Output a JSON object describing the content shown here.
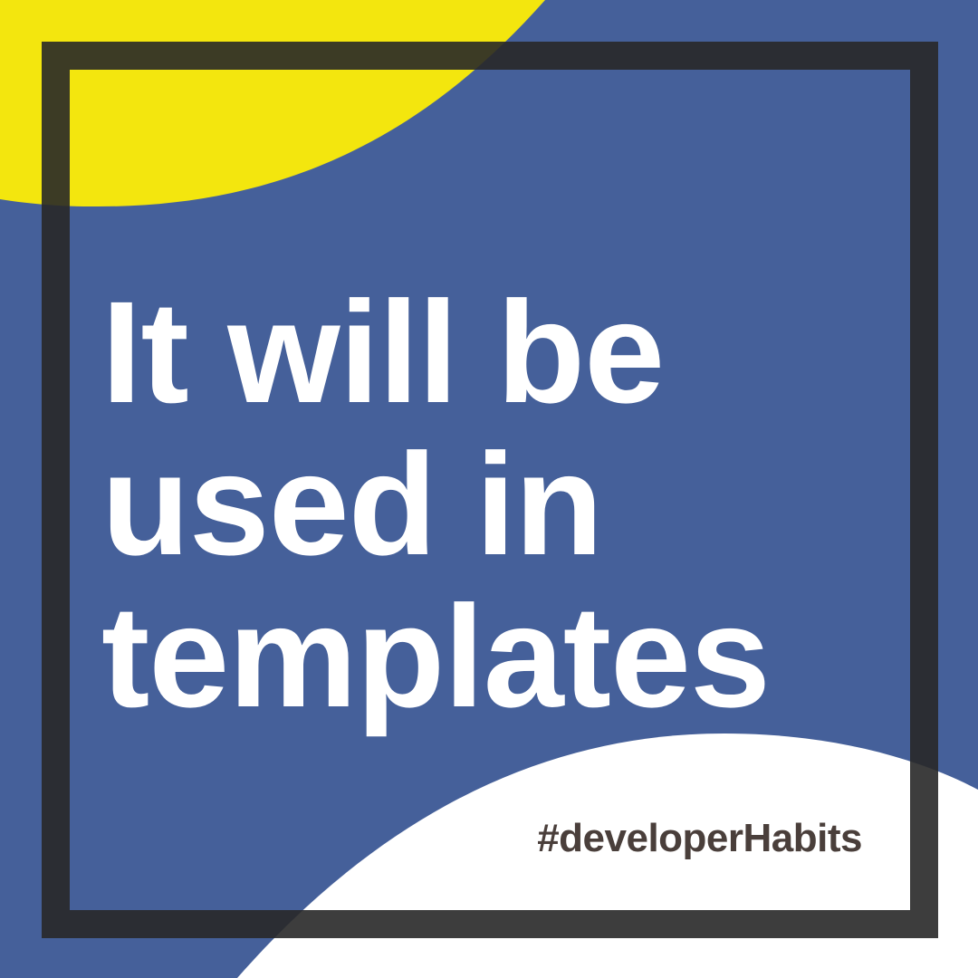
{
  "headline": {
    "lines": [
      "It will be",
      "used in",
      "templates"
    ]
  },
  "hashtag": "#developerHabits",
  "colors": {
    "background_blue": "#45609a",
    "accent_yellow": "#f3e60e",
    "white": "#ffffff",
    "frame_dark": "#282828",
    "hashtag_text": "#4a3f3b"
  }
}
